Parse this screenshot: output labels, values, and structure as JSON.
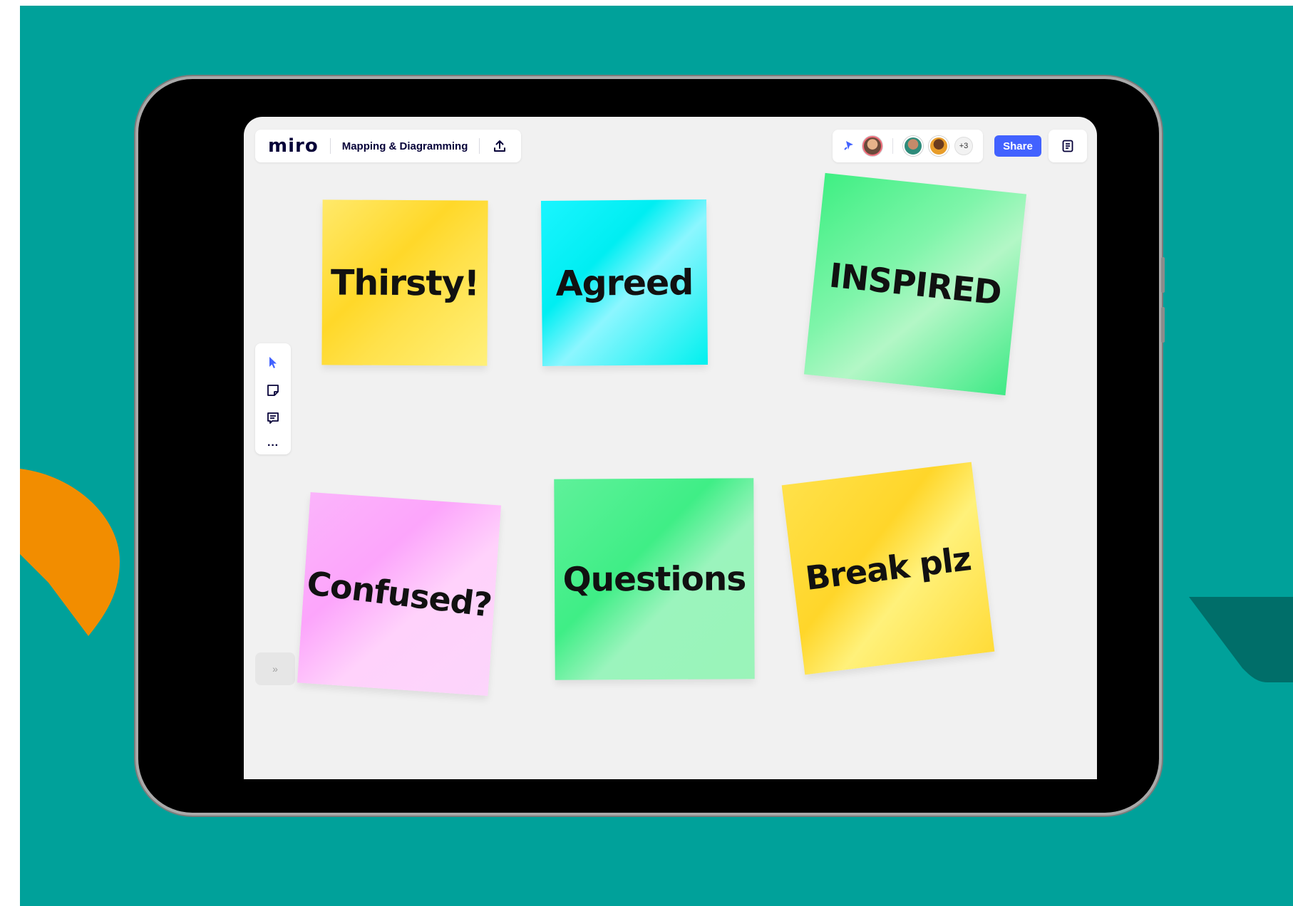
{
  "app": {
    "logo": "miro",
    "board_title": "Mapping & Diagramming"
  },
  "collaborators": {
    "extra_count": "+3"
  },
  "buttons": {
    "share": "Share",
    "expand": "»"
  },
  "toolbar": {
    "tools": [
      "select-icon",
      "sticky-note-icon",
      "comment-icon",
      "more-icon"
    ],
    "more": "···"
  },
  "stickies": [
    {
      "text": "Thirsty!",
      "color": "#ffd829"
    },
    {
      "text": "Agreed",
      "color": "#00eef2"
    },
    {
      "text": "INSPIRED",
      "color": "#55f08f"
    },
    {
      "text": "Confused?",
      "color": "#fbb4fb"
    },
    {
      "text": "Questions",
      "color": "#4ff08b"
    },
    {
      "text": "Break plz",
      "color": "#ffd62a"
    }
  ],
  "colors": {
    "background": "#00a19a",
    "accent": "#4262ff",
    "orange": "#f28d00",
    "dark_teal": "#006e69"
  }
}
